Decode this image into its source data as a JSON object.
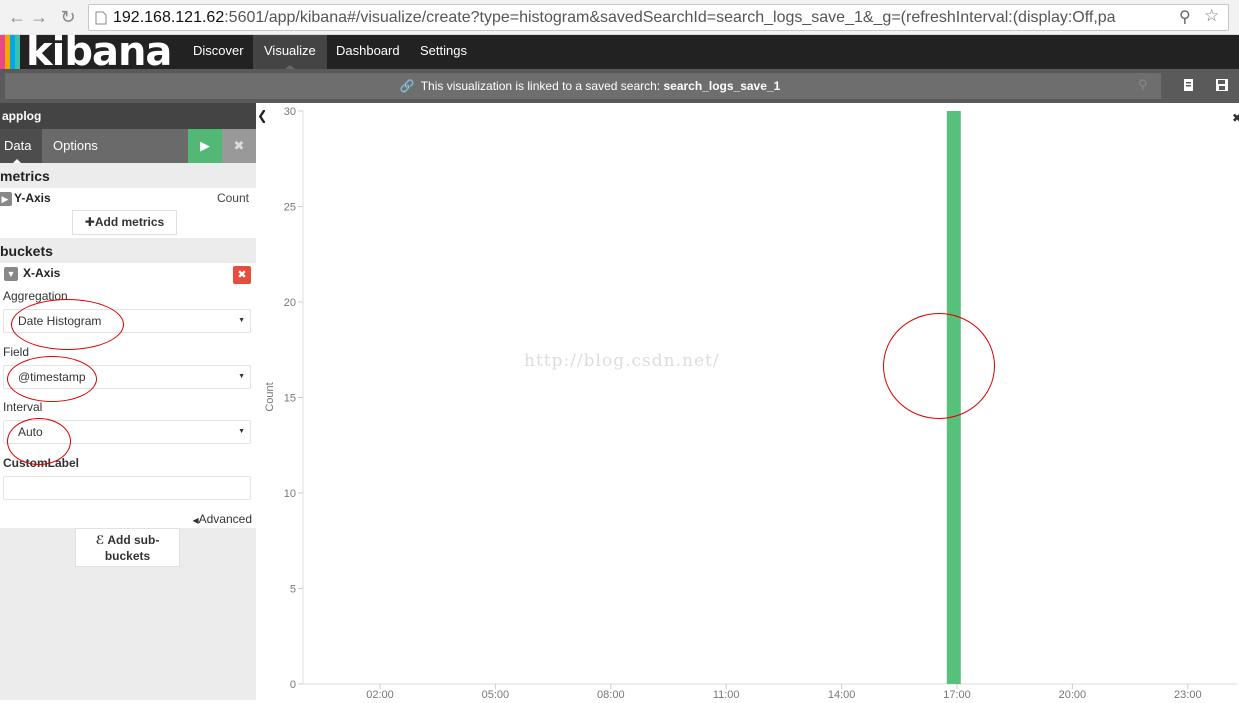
{
  "browser": {
    "url_host": "192.168.121.62",
    "url_rest": ":5601/app/kibana#/visualize/create?type=histogram&savedSearchId=search_logs_save_1&_g=(refreshInterval:(display:Off,pa"
  },
  "nav": {
    "logo": "kibana",
    "tabs": [
      "Discover",
      "Visualize",
      "Dashboard",
      "Settings"
    ],
    "active_tab": "Visualize"
  },
  "link_bar": {
    "prefix": "This visualization is linked to a saved search:",
    "search_name": "search_logs_save_1"
  },
  "sidebar": {
    "index_name": "applog",
    "tabs": [
      "Data",
      "Options"
    ],
    "metrics_title": "metrics",
    "y_axis_label": "Y-Axis",
    "y_axis_value": "Count",
    "add_metrics": "Add metrics",
    "buckets_title": "buckets",
    "x_axis_label": "X-Axis",
    "aggregation_label": "Aggregation",
    "aggregation_value": "Date Histogram",
    "field_label": "Field",
    "field_value": "@timestamp",
    "interval_label": "Interval",
    "interval_value": "Auto",
    "custom_label_label": "CustomLabel",
    "custom_label_value": "",
    "advanced": "Advanced",
    "add_sub_buckets": "Add sub-buckets"
  },
  "watermark": "http://blog.csdn.net/",
  "colors": {
    "bar": "#57c17b",
    "apply": "#52b875",
    "remove": "#e74c3c",
    "annotation": "#dd0000"
  },
  "chart_data": {
    "type": "bar",
    "ylabel": "Count",
    "xlabel": "",
    "x_ticks": [
      "02:00",
      "05:00",
      "08:00",
      "11:00",
      "14:00",
      "17:00",
      "20:00",
      "23:00"
    ],
    "y_ticks": [
      "0",
      "5",
      "10",
      "15",
      "20",
      "25",
      "30"
    ],
    "ylim": [
      0,
      30
    ],
    "bars": [
      {
        "x": "16:55",
        "value": 30
      }
    ]
  }
}
